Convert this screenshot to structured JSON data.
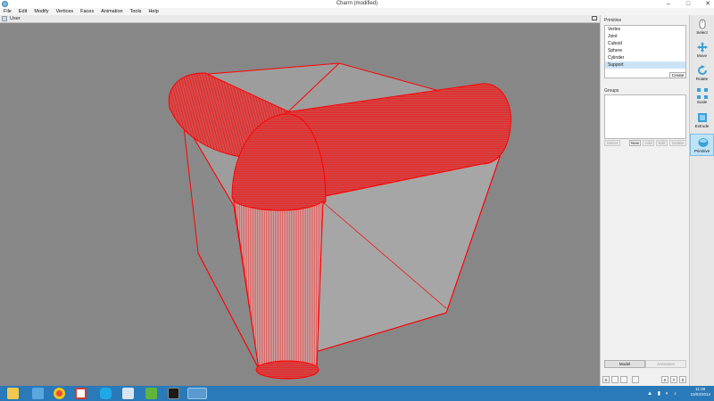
{
  "window": {
    "title": "Charm (modified)"
  },
  "menu": [
    "File",
    "Edit",
    "Modify",
    "Vertices",
    "Faces",
    "Animation",
    "Tools",
    "Help"
  ],
  "viewport": {
    "label": "User"
  },
  "primitive_panel": {
    "title": "Primitive",
    "items": [
      "Vertex",
      "Joint",
      "Cuboid",
      "Sphere",
      "Cylinder",
      "Support"
    ],
    "selected": "Support",
    "create_label": "Create"
  },
  "groups_panel": {
    "title": "Groups",
    "buttons": [
      "Select",
      "New",
      "Add",
      "Edit",
      "Delete"
    ]
  },
  "mode_tabs": {
    "model": "Model",
    "animation": "Animation"
  },
  "tools": [
    {
      "label": "Select",
      "icon": "select-icon"
    },
    {
      "label": "Move",
      "icon": "move-icon"
    },
    {
      "label": "Rotate",
      "icon": "rotate-icon"
    },
    {
      "label": "Scale",
      "icon": "scale-icon"
    },
    {
      "label": "Extrude",
      "icon": "extrude-icon"
    },
    {
      "label": "Primitive",
      "icon": "primitive-icon"
    }
  ],
  "axis_buttons": [
    "X",
    "Y",
    "Z"
  ],
  "taskbar": {
    "time": "11:38",
    "date": "10/03/2014",
    "apps": [
      "file-explorer-icon",
      "folder-icon",
      "chrome-icon",
      "gmail-icon",
      "skype-icon",
      "app-icon",
      "qt-creator-icon",
      "terminal-icon",
      "charm-icon"
    ]
  },
  "colors": {
    "wireframe": "#ff0000",
    "viewport_bg": "#878787",
    "taskbar": "#2a79b8",
    "selected_tool": "#bfe3f6"
  }
}
